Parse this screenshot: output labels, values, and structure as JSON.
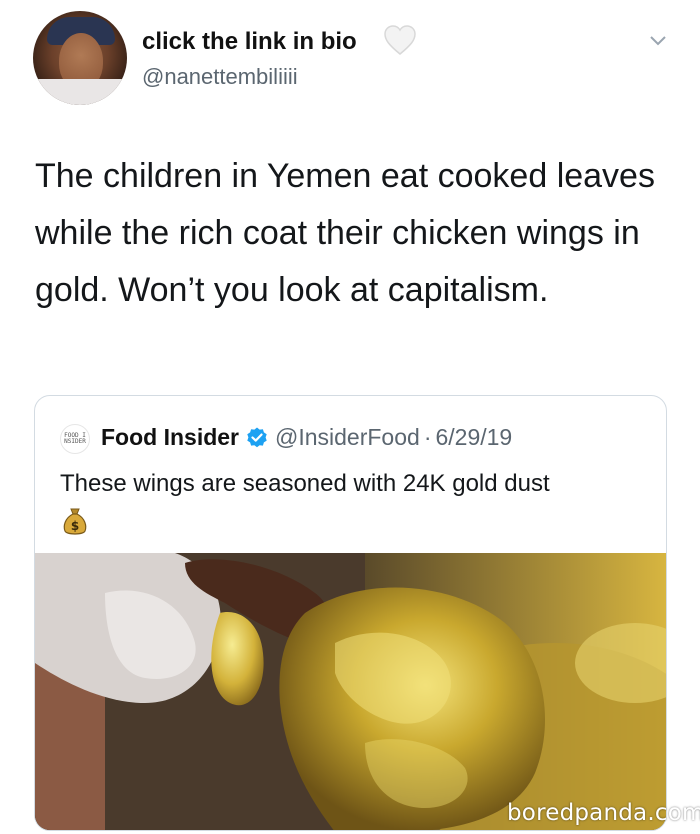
{
  "author": {
    "display_name": "click the link in bio",
    "handle": "@nanettembiliiii",
    "name_emoji_icon": "white-heart-icon"
  },
  "tweet": {
    "text": "The children in Yemen eat cooked leaves while the rich coat their chicken wings in gold. Won’t you look at capitalism."
  },
  "quote": {
    "display_name": "Food Insider",
    "verified_icon": "verified-badge-icon",
    "handle": "@InsiderFood",
    "separator": "·",
    "date": "6/29/19",
    "text": "These wings are seasoned with 24K gold dust",
    "emoji_icon": "money-bag-icon",
    "avatar_text": "FOOD INSIDER",
    "image": "gold-coated-chicken-wing-photo"
  },
  "watermark": "boredpanda.com",
  "colors": {
    "text": "#14171a",
    "muted": "#5b6670",
    "border": "#d3dbe2",
    "verified": "#1da1f2",
    "gold": "#c9a82e"
  }
}
